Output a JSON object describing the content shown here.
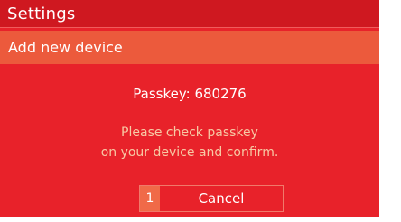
{
  "header": {
    "title": "Settings"
  },
  "dialog": {
    "subtitle": "Add new device",
    "passkey_text": "Passkey: 680276",
    "instruction_line1": "Please check passkey",
    "instruction_line2": "on your device and confirm."
  },
  "actions": {
    "cancel_hotkey": "1",
    "cancel_label": "Cancel"
  },
  "colors": {
    "background": "#e8222a",
    "title_bar": "#cf1820",
    "subtitle_bar": "#ec5a3c",
    "instruction_text": "#f7c9a4"
  }
}
